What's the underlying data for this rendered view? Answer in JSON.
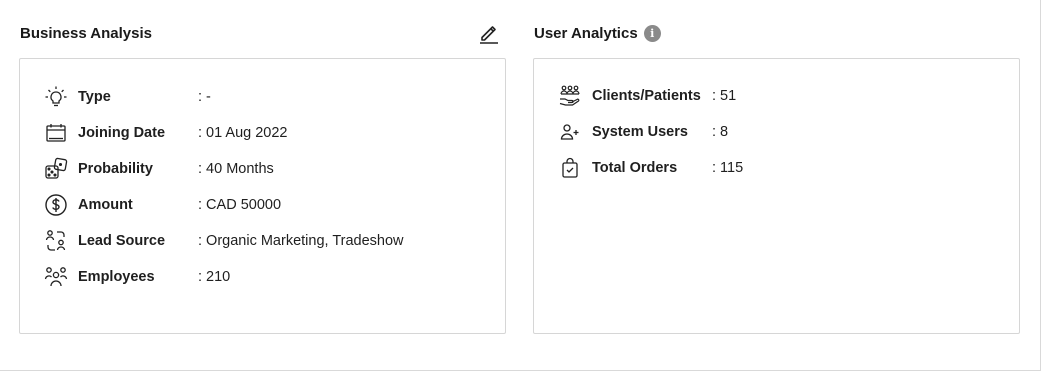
{
  "business": {
    "title": "Business Analysis",
    "rows": [
      {
        "icon": "lightbulb-icon",
        "label": "Type",
        "value": ": -"
      },
      {
        "icon": "calendar-icon",
        "label": "Joining Date",
        "value": ": 01 Aug 2022"
      },
      {
        "icon": "dice-icon",
        "label": "Probability",
        "value": ": 40 Months"
      },
      {
        "icon": "dollar-circle-icon",
        "label": "Amount",
        "value": ": CAD 50000"
      },
      {
        "icon": "lead-source-icon",
        "label": "Lead Source",
        "value": ": Organic Marketing, Tradeshow"
      },
      {
        "icon": "employees-icon",
        "label": "Employees",
        "value": ": 210"
      }
    ]
  },
  "analytics": {
    "title": "User Analytics",
    "info_icon": "i",
    "rows": [
      {
        "icon": "clients-hand-icon",
        "label": "Clients/Patients",
        "value": ": 51"
      },
      {
        "icon": "user-plus-icon",
        "label": "System Users",
        "value": ": 8"
      },
      {
        "icon": "shopping-bag-icon",
        "label": "Total Orders",
        "value": ": 115"
      }
    ]
  }
}
